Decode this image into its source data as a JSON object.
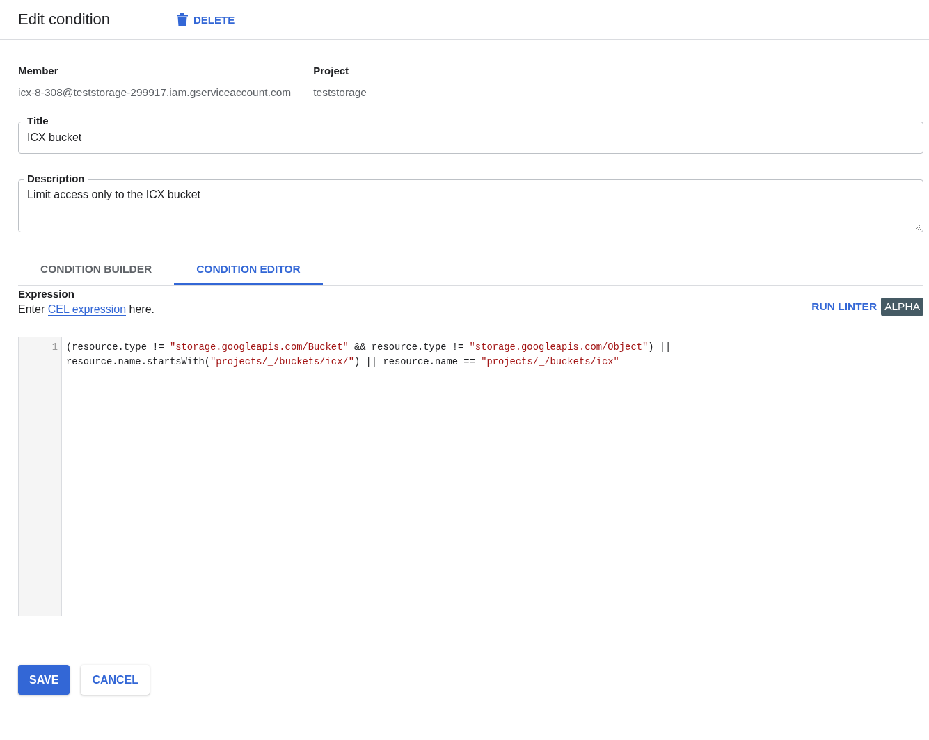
{
  "header": {
    "title": "Edit condition",
    "delete_label": "DELETE"
  },
  "info": [
    {
      "label": "Member",
      "value": "icx-8-308@teststorage-299917.iam.gserviceaccount.com"
    },
    {
      "label": "Project",
      "value": "teststorage"
    }
  ],
  "fields": [
    {
      "kind": "input",
      "label": "Title",
      "value": "ICX bucket"
    },
    {
      "kind": "textarea",
      "label": "Description",
      "value": "Limit access only to the ICX bucket"
    }
  ],
  "tabs": [
    {
      "label": "CONDITION BUILDER",
      "selected": false
    },
    {
      "label": "CONDITION EDITOR",
      "selected": true
    }
  ],
  "expression": {
    "heading": "Expression",
    "hint_before": "Enter",
    "hint_link": "CEL expression",
    "hint_after": "here.",
    "linter_label": "RUN LINTER",
    "badge": "ALPHA"
  },
  "code_lines": [
    {
      "number": "1",
      "rows": [
        [
          {
            "kind": "plain",
            "text": "(resource.type != "
          },
          {
            "kind": "string",
            "text": "\"storage.googleapis.com/Bucket\""
          },
          {
            "kind": "plain",
            "text": " && resource.type != "
          },
          {
            "kind": "string",
            "text": "\"storage.googleapis.com/Object\""
          },
          {
            "kind": "plain",
            "text": ") ||"
          }
        ],
        [
          {
            "kind": "plain",
            "text": "resource.name.startsWith("
          },
          {
            "kind": "string",
            "text": "\"projects/_/buckets/icx/\""
          },
          {
            "kind": "plain",
            "text": ") || resource.name == "
          },
          {
            "kind": "string",
            "text": "\"projects/_/buckets/icx\""
          }
        ]
      ]
    }
  ],
  "actions": [
    {
      "kind": "primary",
      "label": "SAVE"
    },
    {
      "kind": "secondary",
      "label": "CANCEL"
    }
  ]
}
